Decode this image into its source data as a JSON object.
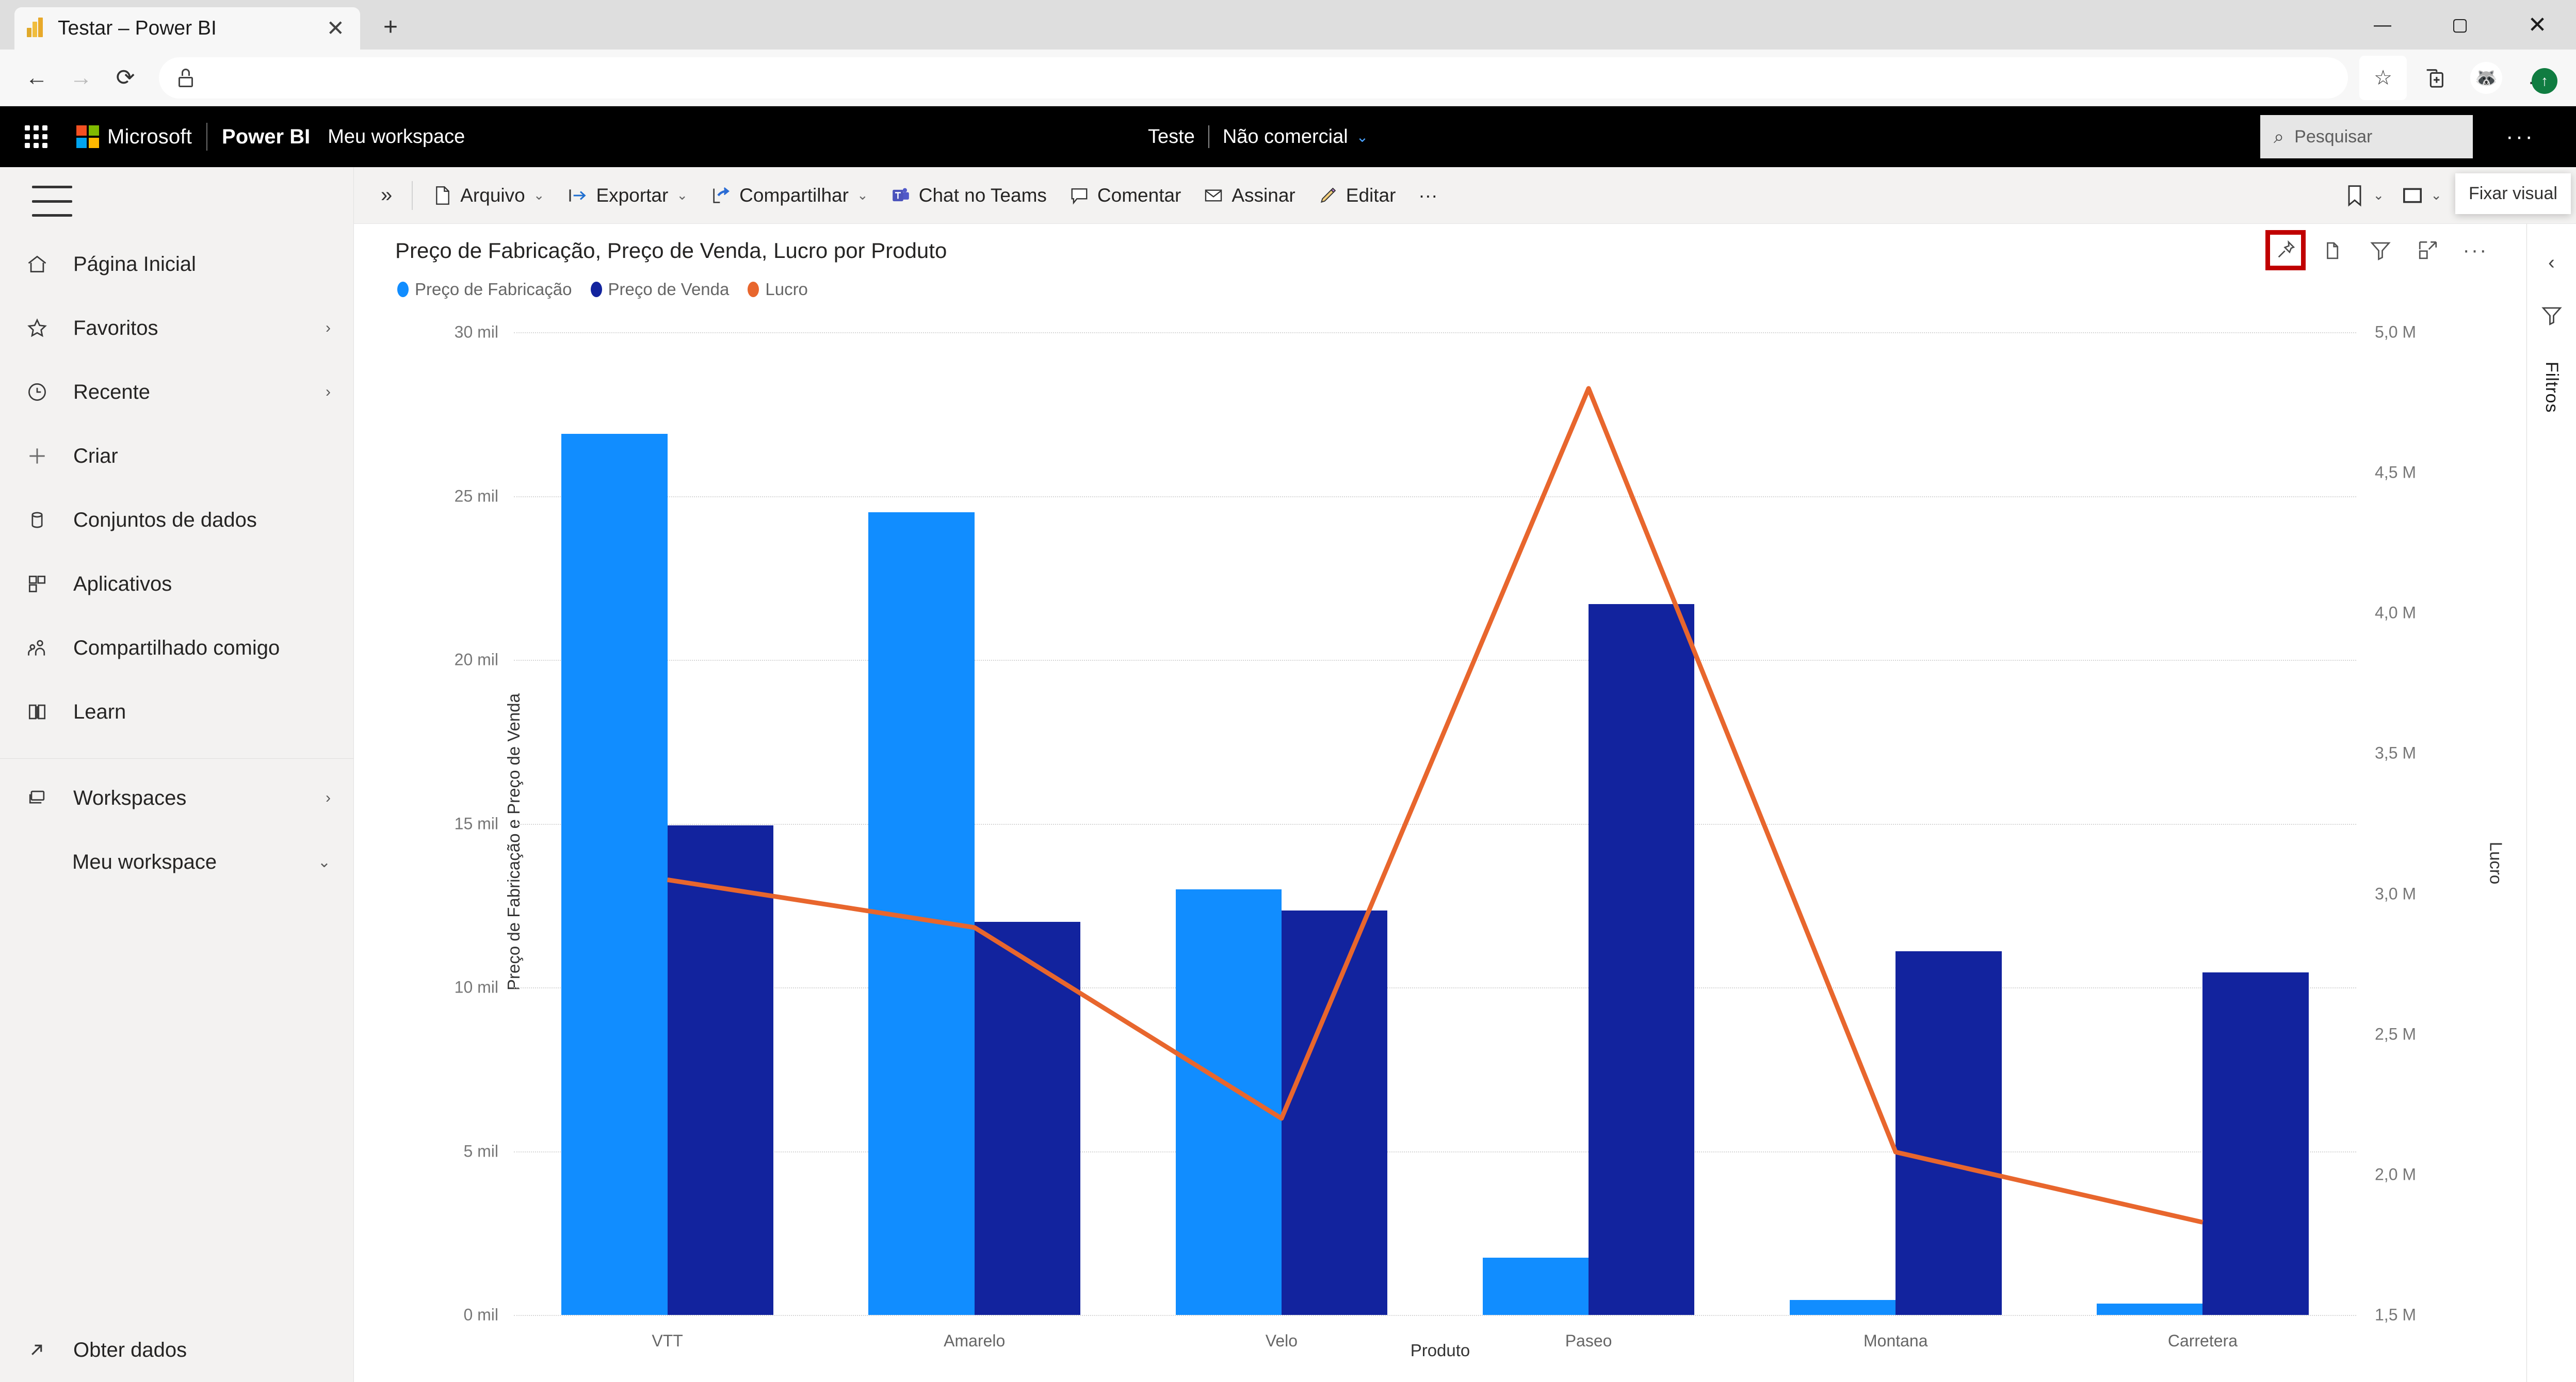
{
  "browser": {
    "tab": {
      "title": "Testar – Power BI",
      "favicon": "powerbi-icon",
      "close": "✕"
    },
    "new_tab": "+",
    "window": {
      "minimize": "—",
      "maximize": "▢",
      "close": "✕"
    },
    "nav": {
      "back": "←",
      "forward": "→",
      "reload": "⟳",
      "lock": "lock-icon",
      "url": ""
    },
    "actions": {
      "favorite": "☆",
      "collections": "collections-icon",
      "profile": "avatar-icon",
      "settings": "…"
    }
  },
  "pbi_header": {
    "waffle": "app-launcher-icon",
    "microsoft": "Microsoft",
    "product": "Power BI",
    "workspace": "Meu workspace",
    "center": {
      "report_name": "Teste",
      "license": "Não comercial",
      "chevron": "⌄"
    },
    "search": {
      "placeholder": "Pesquisar",
      "icon": "search-icon"
    },
    "more": "···"
  },
  "sidebar": {
    "menu_toggle": "hamburger-icon",
    "items": [
      {
        "label": "Página Inicial",
        "icon": "home-icon",
        "chevron": ""
      },
      {
        "label": "Favoritos",
        "icon": "star-icon",
        "chevron": "›"
      },
      {
        "label": "Recente",
        "icon": "clock-icon",
        "chevron": "›"
      },
      {
        "label": "Criar",
        "icon": "plus-icon",
        "chevron": ""
      },
      {
        "label": "Conjuntos de dados",
        "icon": "dataset-icon",
        "chevron": ""
      },
      {
        "label": "Aplicativos",
        "icon": "apps-icon",
        "chevron": ""
      },
      {
        "label": "Compartilhado comigo",
        "icon": "shared-people-icon",
        "chevron": ""
      },
      {
        "label": "Learn",
        "icon": "book-icon",
        "chevron": ""
      }
    ],
    "workspaces": [
      {
        "label": "Workspaces",
        "icon": "workspaces-icon",
        "chevron": "›",
        "sub": false
      },
      {
        "label": "Meu workspace",
        "icon": "",
        "chevron": "⌄",
        "sub": true
      }
    ],
    "bottom": {
      "label": "Obter dados",
      "icon": "get-data-icon"
    }
  },
  "ribbon": {
    "expand": "»",
    "items": [
      {
        "label": "Arquivo",
        "icon": "file-icon",
        "chevron": "⌄"
      },
      {
        "label": "Exportar",
        "icon": "export-icon",
        "chevron": "⌄"
      },
      {
        "label": "Compartilhar",
        "icon": "share-icon",
        "chevron": "⌄"
      },
      {
        "label": "Chat no Teams",
        "icon": "teams-icon",
        "chevron": ""
      },
      {
        "label": "Comentar",
        "icon": "comment-icon",
        "chevron": ""
      },
      {
        "label": "Assinar",
        "icon": "subscribe-icon",
        "chevron": ""
      },
      {
        "label": "Editar",
        "icon": "pencil-icon",
        "chevron": ""
      }
    ],
    "more": "···",
    "right_icons": [
      {
        "name": "bookmark-icon",
        "glyph": "🔖",
        "chevron": "⌄"
      },
      {
        "name": "view-icon",
        "glyph": "▭",
        "chevron": "⌄"
      },
      {
        "name": "refresh-icon",
        "glyph": "⟳",
        "chevron": ""
      },
      {
        "name": "favorite-icon",
        "glyph": "☆",
        "chevron": ""
      }
    ]
  },
  "visual": {
    "title": "Preço de Fabricação, Preço de Venda, Lucro por Produto",
    "tooltip": "Fixar visual",
    "toolbar": [
      {
        "name": "pin-visual-icon",
        "glyph": "📌",
        "highlighted": true
      },
      {
        "name": "copy-visual-icon",
        "glyph": "🗅",
        "highlighted": false
      },
      {
        "name": "filter-icon",
        "glyph": "▽",
        "highlighted": false
      },
      {
        "name": "focus-mode-icon",
        "glyph": "⤢",
        "highlighted": false
      },
      {
        "name": "more-options-icon",
        "glyph": "···",
        "highlighted": false
      }
    ]
  },
  "filters_rail": {
    "collapse": "‹",
    "filter_icon": "filter-funnel-icon",
    "label": "Filtros"
  },
  "chart_data": {
    "type": "bar",
    "title": "Preço de Fabricação, Preço de Venda, Lucro por Produto",
    "xlabel": "Produto",
    "ylabel": "Preço de Fabricação e Preço de Venda",
    "y2label": "Lucro",
    "categories": [
      "VTT",
      "Amarelo",
      "Velo",
      "Paseo",
      "Montana",
      "Carretera"
    ],
    "ylim": [
      0,
      30000
    ],
    "yticks": [
      0,
      5000,
      10000,
      15000,
      20000,
      25000,
      30000
    ],
    "ytick_labels": [
      "0 mil",
      "5 mil",
      "10 mil",
      "15 mil",
      "20 mil",
      "25 mil",
      "30 mil"
    ],
    "y2lim": [
      1500000,
      5000000
    ],
    "y2ticks": [
      1500000,
      2000000,
      2500000,
      3000000,
      3500000,
      4000000,
      4500000,
      5000000
    ],
    "y2tick_labels": [
      "1,5 M",
      "2,0 M",
      "2,5 M",
      "3,0 M",
      "3,5 M",
      "4,0 M",
      "4,5 M",
      "5,0 M"
    ],
    "grid": true,
    "legend_position": "top-left",
    "series": [
      {
        "name": "Preço de Fabricação",
        "type": "bar",
        "axis": "left",
        "color": "#118DFF",
        "values": [
          26900,
          24500,
          13000,
          1750,
          450,
          350
        ]
      },
      {
        "name": "Preço de Venda",
        "type": "bar",
        "axis": "left",
        "color": "#12239E",
        "values": [
          14950,
          12000,
          12350,
          21700,
          11100,
          10450
        ]
      },
      {
        "name": "Lucro",
        "type": "line",
        "axis": "right",
        "color": "#E8662D",
        "values": [
          3050000,
          2880000,
          2200000,
          4800000,
          2080000,
          1830000
        ]
      }
    ]
  }
}
